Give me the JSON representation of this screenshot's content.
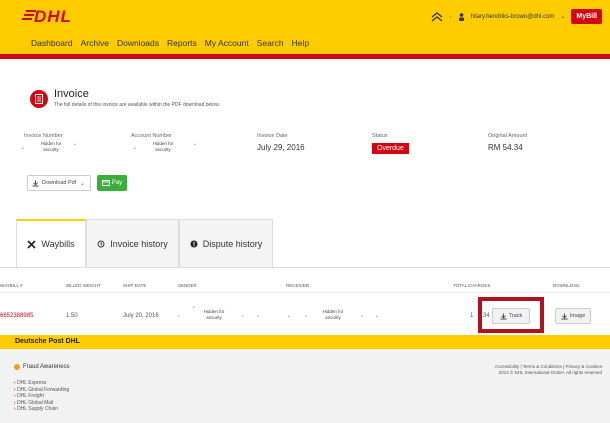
{
  "header": {
    "logo_text": "DHL",
    "nav": [
      "Dashboard",
      "Archive",
      "Downloads",
      "Reports",
      "My Account",
      "Search",
      "Help"
    ],
    "user_email": "hilary.hendriks-brown@dhl.com",
    "mybill_label": "MyBill",
    "colors": {
      "brand_yellow": "#ffcc00",
      "brand_red": "#d40511"
    }
  },
  "invoice": {
    "title": "Invoice",
    "subtitle": "The full details of this invoice are available within the PDF download below.",
    "fields": {
      "invoice_number_label": "Invoice Number",
      "invoice_number_value": "Hidden for security",
      "account_number_label": "Account Number",
      "account_number_value": "Hidden for security",
      "invoice_date_label": "Invoice Date",
      "invoice_date_value": "July 29, 2016",
      "status_label": "Status",
      "status_value": "Overdue",
      "original_amount_label": "Original Amount",
      "original_amount_value": "RM 54.34"
    },
    "download_label": "Download Pdf",
    "pay_label": "Pay"
  },
  "tabs": [
    {
      "label": "Waybills",
      "icon": "plane-icon"
    },
    {
      "label": "Invoice history",
      "icon": "history-icon"
    },
    {
      "label": "Dispute history",
      "icon": "alert-icon"
    }
  ],
  "table": {
    "headers": [
      "Waybill #",
      "Billed Weight",
      "Ship Date",
      "Sender",
      "Receiver",
      "Total Charges",
      "Download"
    ],
    "row": {
      "waybill": "6652388985",
      "weight": "1.50",
      "ship_date": "July 20, 2016",
      "sender": "Hidden for security",
      "receiver": "Hidden for security",
      "total_partial": "1",
      "total_partial_end": "34",
      "track_label": "Track",
      "image_label": "Image"
    }
  },
  "footer": {
    "bar_title": "Deutsche Post DHL",
    "fraud_label": "Fraud Awareness",
    "links": [
      "DHL Express",
      "DHL Global Forwarding",
      "DHL Freight",
      "DHL Global Mail",
      "DHL Supply Chain"
    ],
    "legal_line1": "Accessibility | Terms & Conditions | Privacy & Cookies",
    "legal_line2": "2014 © DHL International GmbH. All rights reserved"
  }
}
